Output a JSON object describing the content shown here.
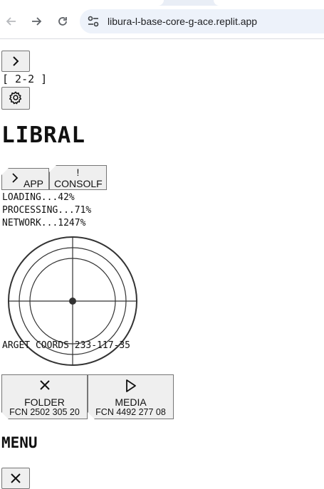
{
  "browser": {
    "url": "libura-l-base-core-g-ace.replit.app",
    "icons": {
      "back": "arrow-left-icon",
      "forward": "arrow-right-icon",
      "reload": "reload-icon",
      "site_info": "tune-icon"
    }
  },
  "page": {
    "expand_icon": "chevron-right-icon",
    "range_label": "[ 2-2 ]",
    "settings_icon": "gear-icon",
    "title": "LIBRAL",
    "tabs": [
      {
        "label": "APP",
        "icon": "chevron-right-icon"
      },
      {
        "label": "CONSOLF",
        "icon": "exclamation-icon",
        "icon_text": "!"
      }
    ],
    "status": [
      {
        "text": "LOADING...42%"
      },
      {
        "text": "PROCESSING...71%"
      },
      {
        "text": "NETWORK...1247%"
      }
    ],
    "radar": {
      "icon": "radar-icon"
    },
    "target_coords": "ARGET COORDS 233-117-35",
    "cards": [
      {
        "name": "FOLDER",
        "code": "FCN 2502 305 20",
        "icon": "close-x-icon"
      },
      {
        "name": "MEDIA",
        "code": "FCN 4492 277 08",
        "icon": "play-icon"
      }
    ],
    "menu_title": "MENU",
    "close_icon": "close-x-icon"
  },
  "colors": {
    "button_bg": "#efefef",
    "button_border": "#767676",
    "omnibox_bg": "#edf2fa"
  }
}
